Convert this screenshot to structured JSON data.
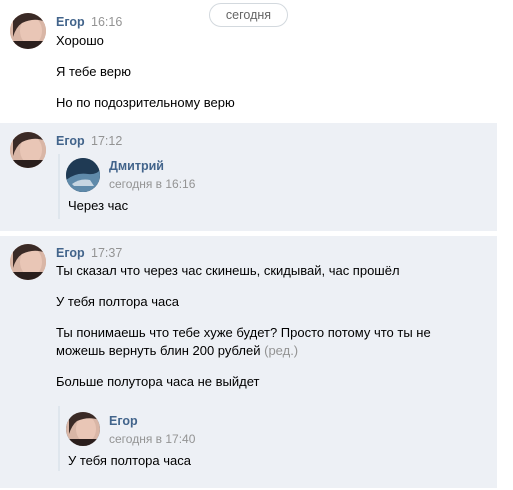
{
  "date_divider": "сегодня",
  "messages": [
    {
      "author": "Егор",
      "time": "16:16",
      "lines": [
        "Хорошо",
        "Я тебе верю",
        "Но по подозрительному верю"
      ]
    },
    {
      "author": "Егор",
      "time": "17:12",
      "forward": {
        "author": "Дмитрий",
        "time": "сегодня в 16:16",
        "text": "Через час"
      }
    },
    {
      "author": "Егор",
      "time": "17:37",
      "lines": [
        "Ты сказал что через час скинешь, скидывай, час прошёл",
        "У тебя полтора часа",
        "Ты понимаешь что тебе хуже будет? Просто потому что ты не",
        "можешь вернуть блин 200 рублей",
        "Больше полутора часа не выйдет"
      ],
      "edited_label": "(ред.)",
      "forward": {
        "author": "Егор",
        "time": "сегодня в 17:40",
        "text": "У тебя полтора часа"
      }
    }
  ],
  "icons": {
    "avatar_egor": "user-avatar-photo",
    "avatar_dmitry": "user-avatar-photo"
  },
  "colors": {
    "author": "#42648b",
    "highlight_bg": "#edf0f5",
    "meta": "#939393"
  }
}
